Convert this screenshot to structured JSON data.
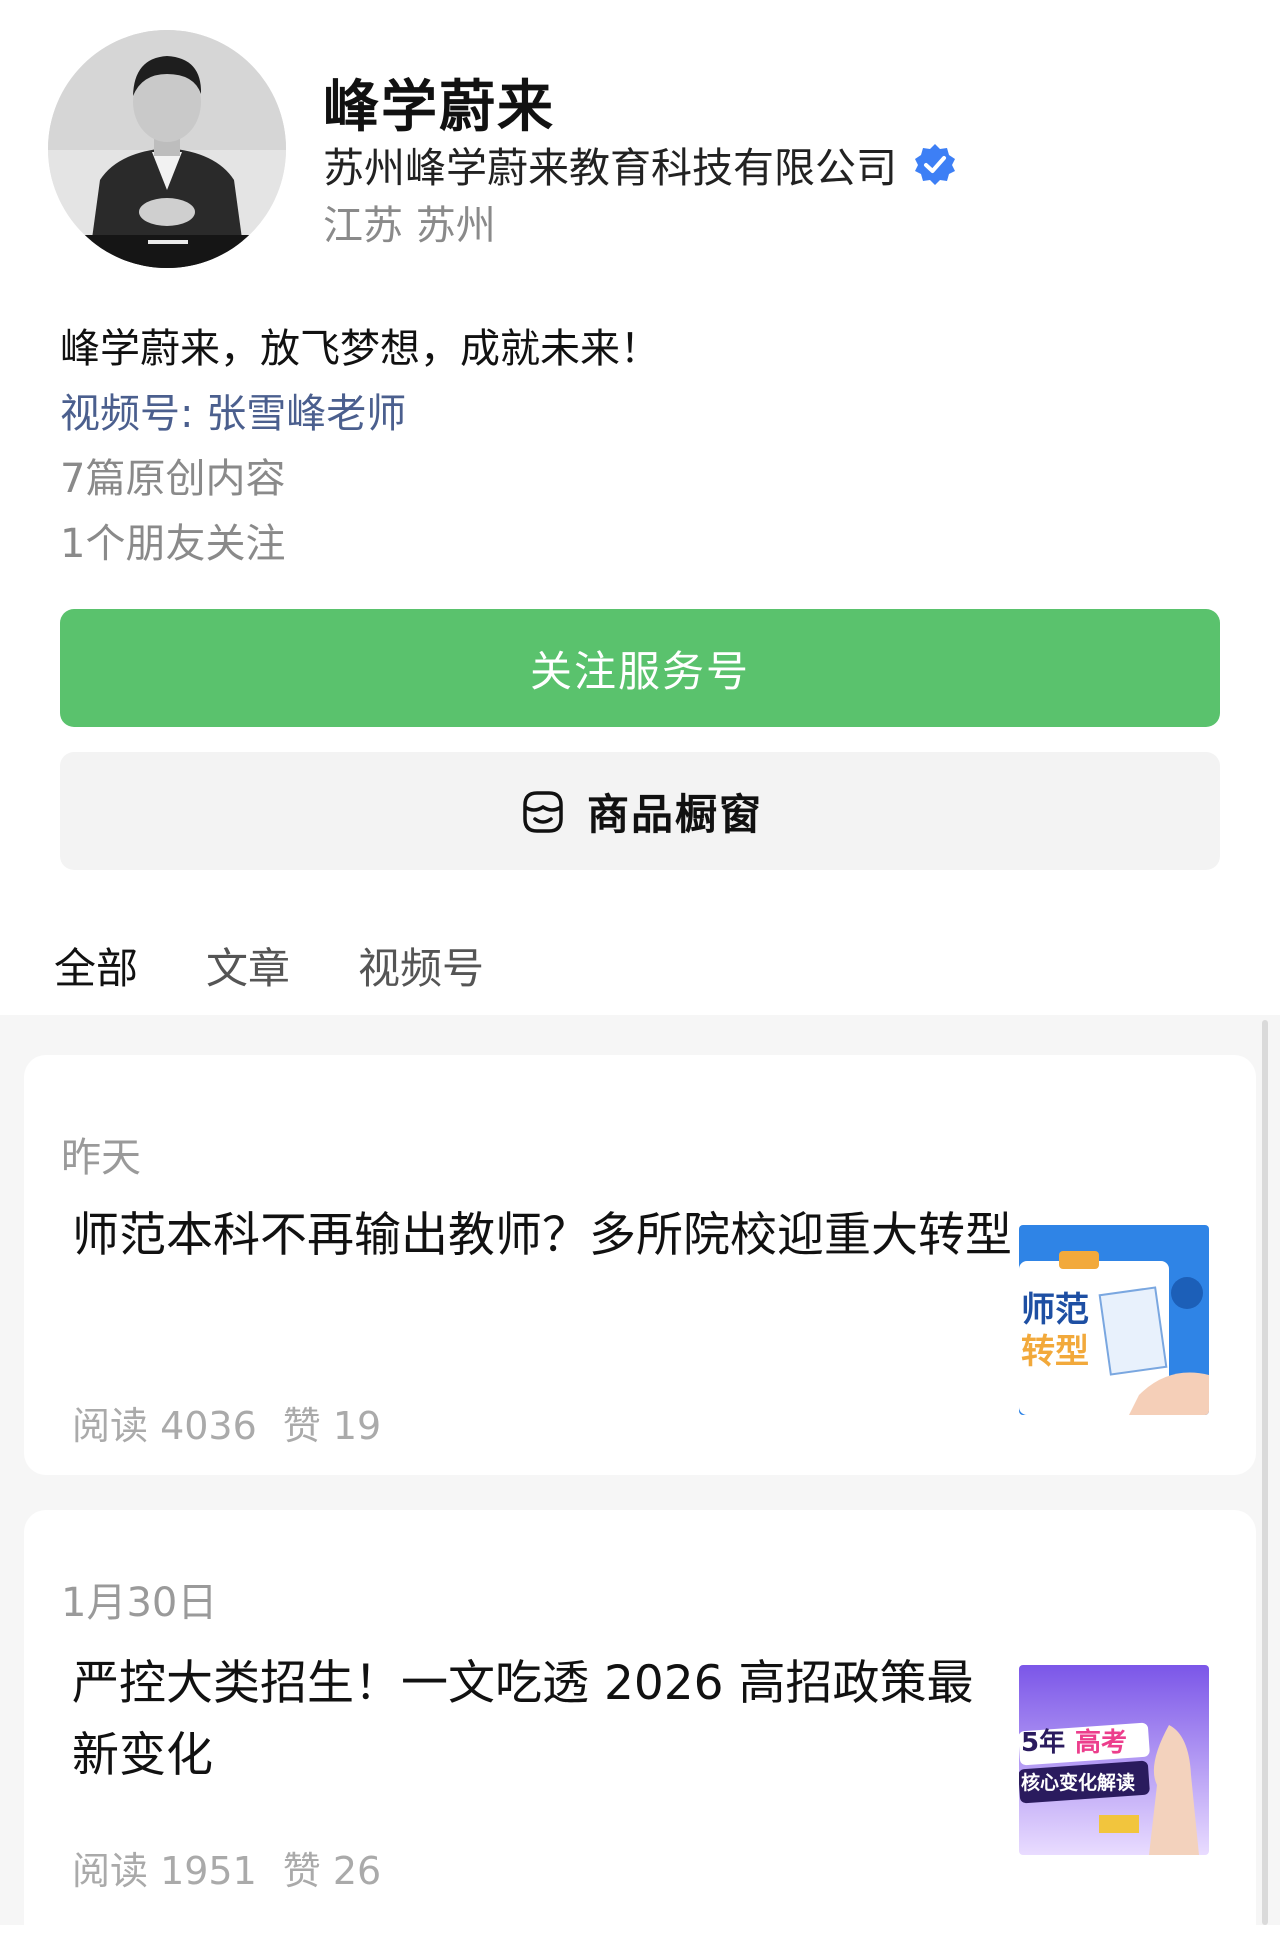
{
  "profile": {
    "name": "峰学蔚来",
    "company": "苏州峰学蔚来教育科技有限公司",
    "region": "江苏 苏州",
    "slogan": "峰学蔚来，放飞梦想，成就未来！",
    "channel": "视频号: 张雪峰老师",
    "original_count": "7篇原创内容",
    "friends_following": "1个朋友关注",
    "verified_icon": "verified-badge-icon",
    "colors": {
      "follow_button": "#5ac26d",
      "channel_link": "#4b5f8e",
      "verified": "#3d7ff5"
    }
  },
  "actions": {
    "follow_label": "关注服务号",
    "shop_label": "商品橱窗",
    "shop_icon": "storefront-icon"
  },
  "tabs": [
    {
      "label": "全部",
      "active": true
    },
    {
      "label": "文章",
      "active": false
    },
    {
      "label": "视频号",
      "active": false
    }
  ],
  "articles": [
    {
      "date": "昨天",
      "title": "师范本科不再输出教师？多所院校迎重大转型",
      "reads": "阅读 4036",
      "likes": "赞 19",
      "thumb_text": [
        "师范",
        "转型"
      ]
    },
    {
      "date": "1月30日",
      "title": "严控大类招生！一文吃透 2026 高招政策最新变化",
      "reads": "阅读 1951",
      "likes": "赞 26",
      "thumb_text": [
        "5年",
        "高考",
        "核心变化解读"
      ]
    }
  ]
}
